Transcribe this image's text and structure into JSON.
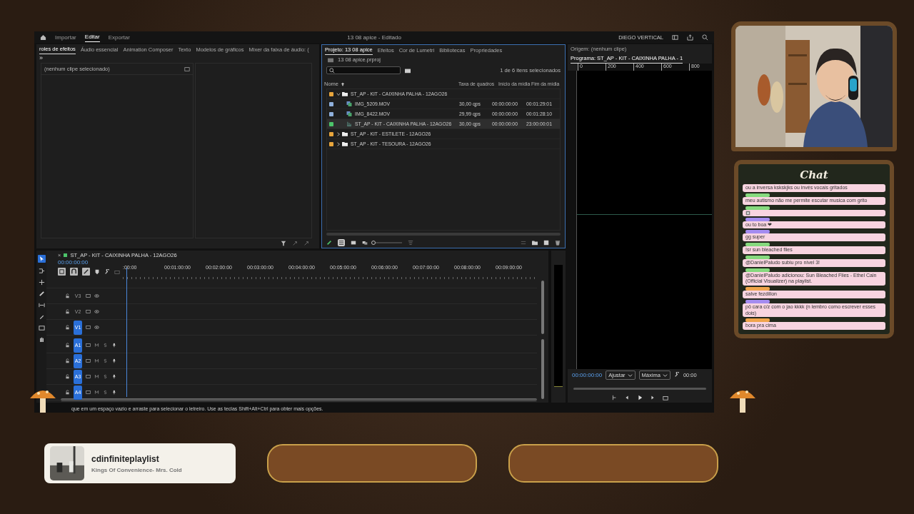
{
  "premiere": {
    "workspace_tabs": [
      {
        "label": "Importar",
        "selected": false
      },
      {
        "label": "Editar",
        "selected": true
      },
      {
        "label": "Exportar",
        "selected": false
      }
    ],
    "title": "13 08 apice - Editado",
    "workspace": "DIEGO VERTICAL",
    "effects_panel": {
      "tabs": [
        {
          "label": "roles de efeitos",
          "selected": true
        },
        {
          "label": "Áudio essencial",
          "selected": false
        },
        {
          "label": "Animation Composer",
          "selected": false
        },
        {
          "label": "Texto",
          "selected": false
        },
        {
          "label": "Modelos de gráficos",
          "selected": false
        },
        {
          "label": "Mixer da faixa de áudio: (",
          "selected": false
        }
      ],
      "more": "»",
      "message": "(nenhum clipe selecionado)"
    },
    "project_panel": {
      "tabs": [
        {
          "label": "Projeto: 13 08 apice",
          "selected": true
        },
        {
          "label": "Efeitos",
          "selected": false
        },
        {
          "label": "Cor de Lumetri",
          "selected": false
        },
        {
          "label": "Bibliotecas",
          "selected": false
        },
        {
          "label": "Propriedades",
          "selected": false
        }
      ],
      "file": "13 08 apice.prproj",
      "selection_count": "1 de 6 itens selecionados",
      "columns": [
        "Nome",
        "Taxa de quadros",
        "Início da mídia",
        "Fim da mídia"
      ],
      "items": [
        {
          "name": "ST_AP - KIT - CAIXINHA PALHA - 12AGO26",
          "kind": "folder",
          "color": "#e8a53c",
          "expanded": true,
          "selected": false,
          "children": [
            {
              "name": "IMG_5209.MOV",
              "kind": "clip",
              "color": "#8fb0dc",
              "selected": false,
              "rate": "30,00 qps",
              "start": "00:00:00:00",
              "end": "00:01:29:01"
            },
            {
              "name": "IMG_8422.MOV",
              "kind": "clip",
              "color": "#8fb0dc",
              "selected": false,
              "rate": "29,99 qps",
              "start": "00:00:00:00",
              "end": "00:01:28:10"
            },
            {
              "name": "ST_AP - KIT - CAIXINHA PALHA - 12AGO26",
              "kind": "sequence",
              "color": "#4cc46a",
              "selected": true,
              "rate": "30,00 qps",
              "start": "00:00:00:00",
              "end": "23:00:00:01"
            }
          ]
        },
        {
          "name": "ST_AP - KIT - ESTILETE - 12AGO26",
          "kind": "folder",
          "color": "#e8a53c",
          "expanded": false,
          "selected": false
        },
        {
          "name": "ST_AP - KIT - TESOURA - 12AGO26",
          "kind": "folder",
          "color": "#e8a53c",
          "expanded": false,
          "selected": false
        }
      ],
      "zoom_slider": {
        "level": 0
      }
    },
    "monitor": {
      "tabs": [
        {
          "label": "Origem: (nenhum clipe)",
          "selected": false
        },
        {
          "label": "Programa: ST_AP - KIT - CAIXINHA PALHA - 1",
          "selected": true
        }
      ],
      "ruler": [
        "0",
        "200",
        "400",
        "600",
        "800"
      ],
      "timecode": "00:00:00:00",
      "zoom": "Ajustar",
      "quality": "Máxima",
      "duration": "00:00"
    },
    "timeline": {
      "close": "×",
      "sequence": "ST_AP - KIT - CAIXINHA PALHA - 12AGO26",
      "timecode": "00:00:00:00",
      "ruler": [
        ":00:00",
        "00:01:00:00",
        "00:02:00:00",
        "00:03:00:00",
        "00:04:00:00",
        "00:05:00:00",
        "00:06:00:00",
        "00:07:00:00",
        "00:08:00:00",
        "00:09:00:00"
      ],
      "video_tracks": [
        {
          "label": "V3",
          "targeted": false
        },
        {
          "label": "V2",
          "targeted": false
        },
        {
          "label": "V1",
          "targeted": true
        }
      ],
      "audio_tracks": [
        {
          "label": "A1",
          "targeted": true
        },
        {
          "label": "A2",
          "targeted": true
        },
        {
          "label": "A3",
          "targeted": true
        },
        {
          "label": "A4",
          "targeted": true
        }
      ]
    },
    "status": "que em um espaço vazio e arraste para selecionar o letreiro. Use as teclas Shift+Alt+Ctrl para obter mais opções."
  },
  "chat": {
    "title": "Chat",
    "messages": [
      {
        "kind": "text",
        "text": "ou a inversa kskskjks ou invés vocais gritados"
      },
      {
        "kind": "text",
        "color": "#86d97e",
        "text": "meu autismo não me permite escutar musica com grito"
      },
      {
        "kind": "emote",
        "color": "#86d97e"
      },
      {
        "kind": "text",
        "color": "#a48cf0",
        "text": "ou to boa ❤"
      },
      {
        "kind": "text",
        "color": "#a48cf0",
        "text": "gg super"
      },
      {
        "kind": "text",
        "color": "#86d97e",
        "text": "!sr sun bleached flies"
      },
      {
        "kind": "text",
        "color": "#86d97e",
        "text": "@DanielPaludo subiu pro nível 3!"
      },
      {
        "kind": "text",
        "color": "#86d97e",
        "text": "@DanielPaludo adicionou: Sun Bleached Flies - Ethel Cain (Official Visualizer) na playlist."
      },
      {
        "kind": "text",
        "color": "#f0a44c",
        "text": "salve fezdillon"
      },
      {
        "kind": "text",
        "color": "#a48cf0",
        "text": "pô cara c/z com o jao kkkk (n lembro como escrever esses dois)"
      },
      {
        "kind": "text",
        "color": "#f0a44c",
        "text": "bora pra cima"
      }
    ]
  },
  "now_playing": {
    "title": "cdinfiniteplaylist",
    "track": "Kings Of Convenience- Mrs. Cold"
  }
}
